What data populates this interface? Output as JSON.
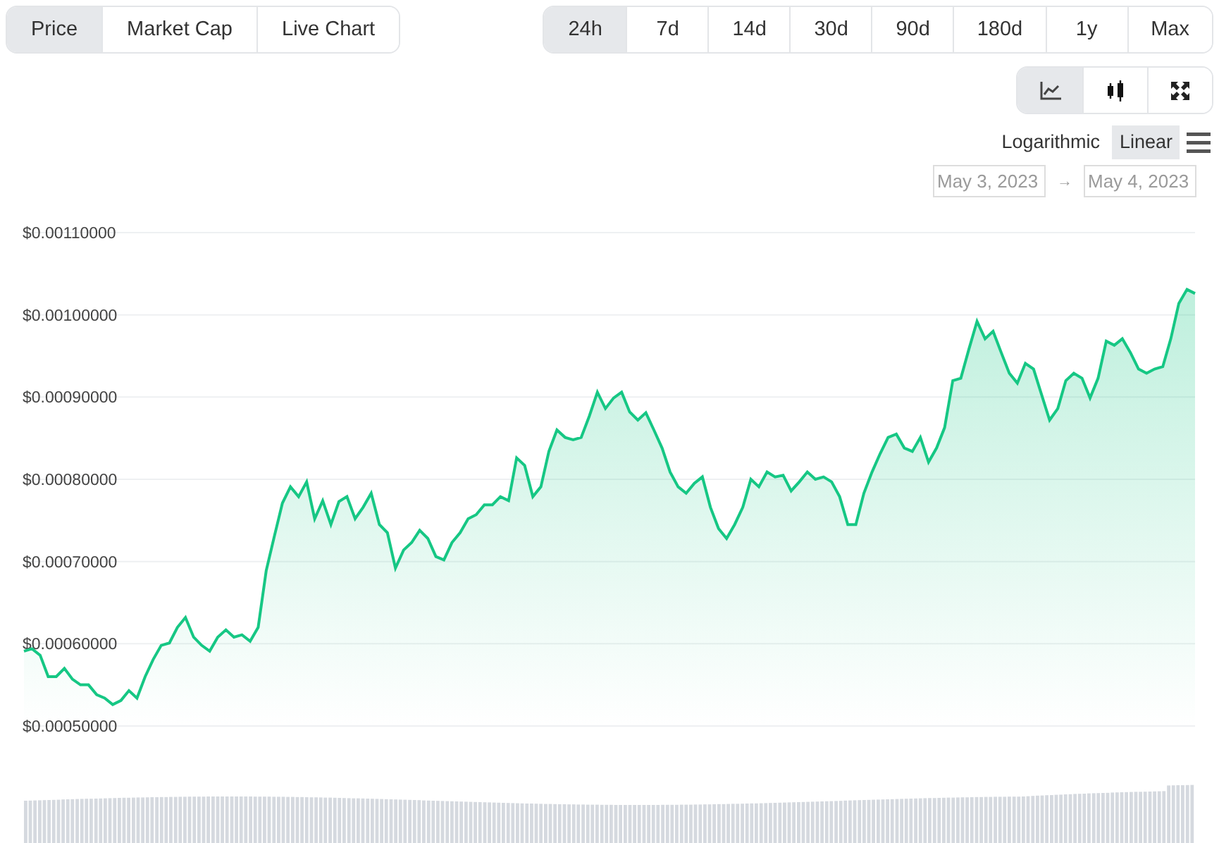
{
  "tabs": [
    {
      "label": "Price",
      "selected": true
    },
    {
      "label": "Market Cap",
      "selected": false
    },
    {
      "label": "Live Chart",
      "selected": false
    }
  ],
  "ranges": [
    {
      "label": "24h",
      "selected": true
    },
    {
      "label": "7d",
      "selected": false
    },
    {
      "label": "14d",
      "selected": false
    },
    {
      "label": "30d",
      "selected": false
    },
    {
      "label": "90d",
      "selected": false
    },
    {
      "label": "180d",
      "selected": false
    },
    {
      "label": "1y",
      "selected": false
    },
    {
      "label": "Max",
      "selected": false
    }
  ],
  "chart_types": [
    {
      "kind": "line",
      "selected": true
    },
    {
      "kind": "candlestick",
      "selected": false
    },
    {
      "kind": "fullscreen",
      "selected": false
    }
  ],
  "scale": [
    {
      "label": "Logarithmic",
      "selected": false
    },
    {
      "label": "Linear",
      "selected": true
    }
  ],
  "date_range": {
    "from": "May 3, 2023",
    "separator": "→",
    "to": "May 4, 2023"
  },
  "chart_data": {
    "type": "area",
    "grid": true,
    "ylim": [
      0.0005,
      0.0011
    ],
    "yticks": [
      {
        "value": 0.0011,
        "label": "$0.00110000"
      },
      {
        "value": 0.001,
        "label": "$0.00100000"
      },
      {
        "value": 0.0009,
        "label": "$0.00090000"
      },
      {
        "value": 0.0008,
        "label": "$0.00080000"
      },
      {
        "value": 0.0007,
        "label": "$0.00070000"
      },
      {
        "value": 0.0006,
        "label": "$0.00060000"
      },
      {
        "value": 0.0005,
        "label": "$0.00050000"
      }
    ],
    "series": [
      {
        "color": "#16c784",
        "values": [
          0.000591,
          0.000594,
          0.000586,
          0.00056,
          0.00056,
          0.00057,
          0.000557,
          0.00055,
          0.00055,
          0.000538,
          0.000534,
          0.000526,
          0.000531,
          0.000543,
          0.000534,
          0.00056,
          0.000581,
          0.000598,
          0.000601,
          0.00062,
          0.000632,
          0.000608,
          0.000598,
          0.000591,
          0.000608,
          0.000617,
          0.000608,
          0.000611,
          0.000603,
          0.00062,
          0.000689,
          0.000731,
          0.000771,
          0.000791,
          0.000779,
          0.000797,
          0.000752,
          0.000774,
          0.000745,
          0.000773,
          0.000779,
          0.000752,
          0.000766,
          0.000783,
          0.000745,
          0.000735,
          0.000692,
          0.000714,
          0.000723,
          0.000738,
          0.000728,
          0.000706,
          0.000702,
          0.000723,
          0.000735,
          0.000752,
          0.000757,
          0.000769,
          0.000769,
          0.000779,
          0.000774,
          0.000826,
          0.000817,
          0.000779,
          0.000791,
          0.000834,
          0.00086,
          0.000851,
          0.000848,
          0.000851,
          0.000877,
          0.000906,
          0.000886,
          0.000899,
          0.000906,
          0.000882,
          0.000872,
          0.000881,
          0.00086,
          0.000838,
          0.000809,
          0.000791,
          0.000783,
          0.000795,
          0.000803,
          0.000766,
          0.00074,
          0.000728,
          0.000745,
          0.000766,
          0.0008,
          0.000791,
          0.000809,
          0.000803,
          0.000805,
          0.000786,
          0.000797,
          0.000809,
          0.0008,
          0.000803,
          0.000797,
          0.000779,
          0.000745,
          0.000745,
          0.000783,
          0.000809,
          0.000831,
          0.000851,
          0.000855,
          0.000838,
          0.000834,
          0.000851,
          0.000821,
          0.000838,
          0.000863,
          0.00092,
          0.000923,
          0.000958,
          0.000992,
          0.000971,
          0.00098,
          0.000954,
          0.000929,
          0.000917,
          0.000941,
          0.000934,
          0.000903,
          0.000872,
          0.000886,
          0.00092,
          0.000929,
          0.000923,
          0.000899,
          0.000923,
          0.000968,
          0.000963,
          0.000971,
          0.000954,
          0.000934,
          0.000929,
          0.000934,
          0.000937,
          0.000971,
          0.001014,
          0.001031,
          0.001026
        ]
      }
    ]
  }
}
